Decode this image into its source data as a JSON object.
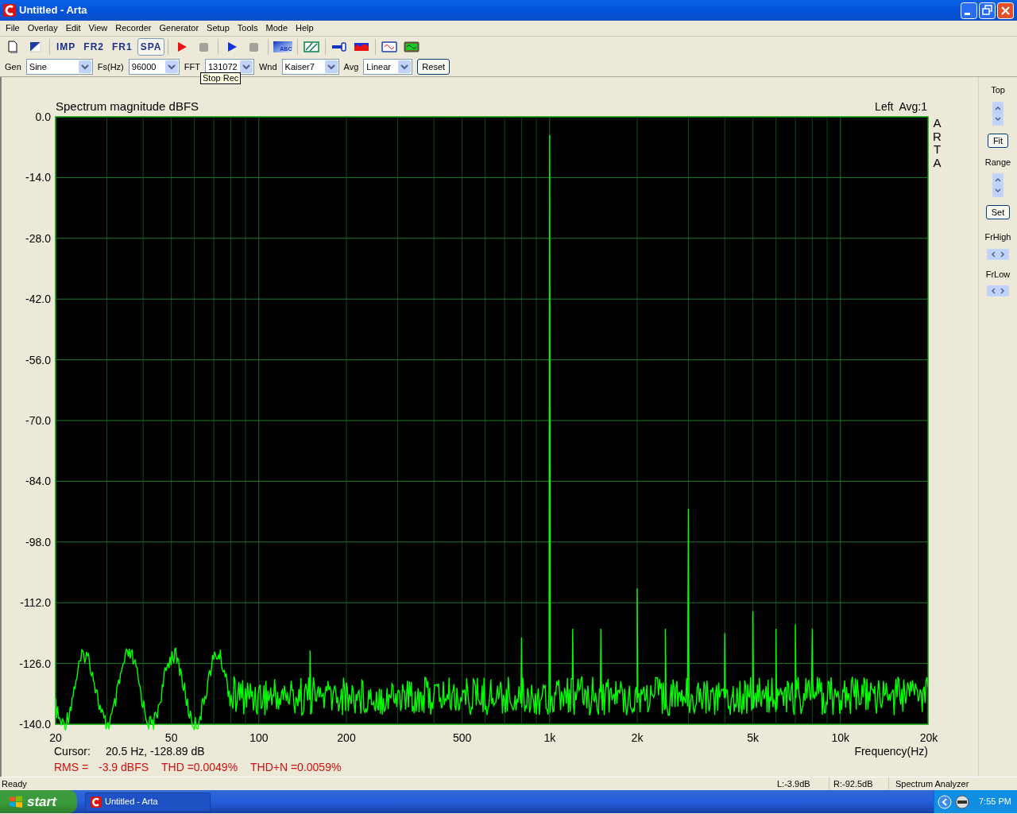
{
  "window": {
    "title": "Untitled - Arta"
  },
  "menu": [
    "File",
    "Overlay",
    "Edit",
    "View",
    "Recorder",
    "Generator",
    "Setup",
    "Tools",
    "Mode",
    "Help"
  ],
  "toolbar": {
    "mode_buttons": [
      {
        "label": "IMP",
        "selected": false
      },
      {
        "label": "FR2",
        "selected": false
      },
      {
        "label": "FR1",
        "selected": false
      },
      {
        "label": "SPA",
        "selected": true
      }
    ],
    "abc_label": "ABC"
  },
  "params": [
    {
      "label": "Gen",
      "value": "Sine"
    },
    {
      "label": "Fs(Hz)",
      "value": "96000"
    },
    {
      "label": "FFT",
      "value": "131072"
    },
    {
      "label": "Wnd",
      "value": "Kaiser7"
    },
    {
      "label": "Avg",
      "value": "Linear"
    }
  ],
  "reset_button": "Reset",
  "tooltip": "Stop Rec",
  "chart_panel": {
    "title": "Spectrum magnitude dBFS",
    "channel": "Left  Avg:1",
    "side_text": "ARTA",
    "y_axis_labels": [
      "0.0",
      "-14.0",
      "-28.0",
      "-42.0",
      "-56.0",
      "-70.0",
      "-84.0",
      "-98.0",
      "-112.0",
      "-126.0",
      "-140.0"
    ],
    "x_axis_labels": [
      "20",
      "50",
      "100",
      "200",
      "500",
      "1k",
      "2k",
      "5k",
      "10k",
      "20k"
    ],
    "x_axis_title": "Frequency(Hz)",
    "cursor": [
      "Cursor:",
      "20.5 Hz, -128.89 dB"
    ],
    "measurements": [
      "RMS =",
      "-3.9 dBFS",
      "THD =0.0049%",
      "THD+N =0.0059%"
    ]
  },
  "side_panel": [
    {
      "kind": "spin",
      "label": "Top"
    },
    {
      "kind": "button",
      "label": "Fit"
    },
    {
      "kind": "spin",
      "label": "Range"
    },
    {
      "kind": "button",
      "label": "Set"
    },
    {
      "kind": "hspin",
      "label": "FrHigh"
    },
    {
      "kind": "hspin",
      "label": "FrLow"
    }
  ],
  "status_bar": [
    "Ready",
    "L:-3.9dB",
    "R:-92.5dB",
    "Spectrum Analyzer"
  ],
  "taskbar": {
    "start": "start",
    "tasks": [
      "Untitled - Arta"
    ],
    "clock": "7:55 PM"
  }
}
